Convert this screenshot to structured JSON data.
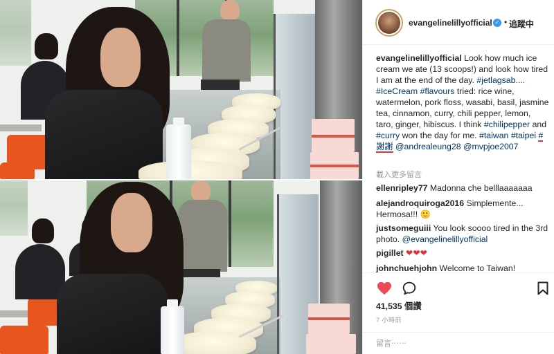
{
  "post": {
    "username": "evangelinelillyofficial",
    "verified_icon": "check-icon",
    "follow_label": "追蹤中",
    "caption": {
      "username": "evangelinelillyofficial",
      "text_1": " Look how much ice cream we ate (13 scoops!) and look how tired I am at the end of the day. ",
      "tag_jetlag": "#jetlagsab....",
      "tag_icecream": "#IceCream",
      "tag_flavours": "#flavours",
      "text_2": " tried: rice wine, watermelon, pork floss, wasabi, basil, jasmine tea, cinnamon, curry, chili pepper, lemon, taro, ginger, hibiscus. I think ",
      "tag_chilipepper": "#chilipepper",
      "text_and": " and ",
      "tag_curry": "#curry",
      "text_3": " won the day for me. ",
      "tag_taiwan": "#taiwan",
      "tag_taipei": "#taipei",
      "tag_thanks": "#謝謝",
      "mention_1": "@andrealeung28",
      "mention_2": "@mvpjoe2007"
    },
    "load_more": "載入更多留言",
    "comments": [
      {
        "user": "ellenripley77",
        "text": " Madonna che belllaaaaaaa"
      },
      {
        "user": "alejandroquiroga2016",
        "text": " Simplemente... Hermosa!!! 🙂"
      },
      {
        "user": "justsomeguiii",
        "text": " You look soooo tired in the 3rd photo. ",
        "mention": "@evangelinelillyofficial"
      },
      {
        "user": "pigillet",
        "text": " ❤❤❤"
      },
      {
        "user": "johnchuehjohn",
        "text": " Welcome to Taiwan!"
      }
    ],
    "likes": "41,535 個讚",
    "timestamp": "7 小時前",
    "add_comment_placeholder": "留言⋯⋯",
    "icons": {
      "like": "heart-icon",
      "comment": "speech-bubble-icon",
      "save": "bookmark-icon"
    },
    "colors": {
      "like_red": "#ed4956",
      "link_blue": "#003569",
      "verified_blue": "#3897f0",
      "highlight_underline": "#e03030"
    }
  }
}
